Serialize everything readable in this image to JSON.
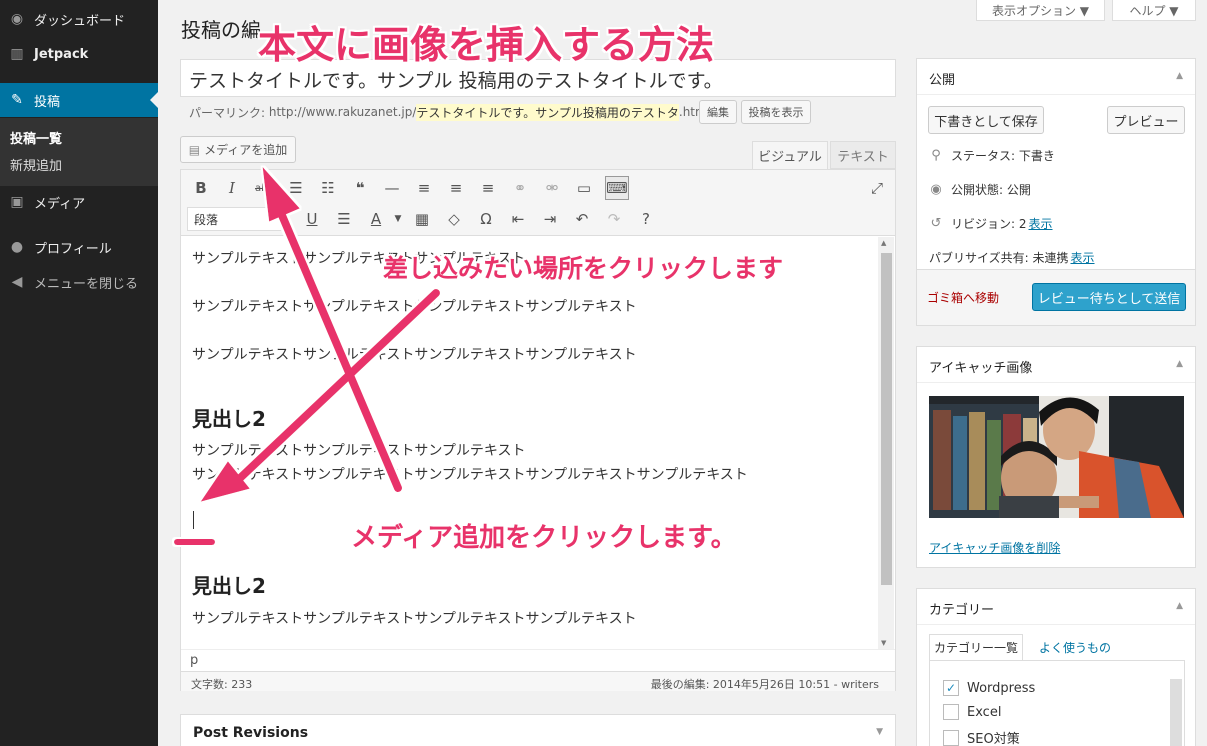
{
  "sidebar": {
    "items": [
      {
        "label": "ダッシュボード",
        "icon": "dashboard-icon"
      },
      {
        "label": "Jetpack",
        "icon": "jetpack-icon"
      },
      {
        "label": "投稿",
        "icon": "pin-icon"
      },
      {
        "label": "メディア",
        "icon": "media-icon"
      },
      {
        "label": "プロフィール",
        "icon": "user-icon"
      },
      {
        "label": "メニューを閉じる",
        "icon": "collapse-icon"
      }
    ],
    "submenu": [
      "投稿一覧",
      "新規追加"
    ]
  },
  "header": {
    "page_title": "投稿の編",
    "screen_options": "表示オプション ▼",
    "help": "ヘルプ ▼"
  },
  "post": {
    "title": "テストタイトルです。サンプル 投稿用のテストタイトルです。",
    "permalink_label": "パーマリンク:",
    "permalink_base": "http://www.rakuzanet.jp/",
    "permalink_slug": "テストタイトルです。サンプル投稿用のテストタ",
    "permalink_ext": ".html",
    "edit_button": "編集",
    "view_button": "投稿を表示"
  },
  "editor": {
    "add_media": "メディアを追加",
    "tab_visual": "ビジュアル",
    "tab_text": "テキスト",
    "format": "段落",
    "lines": [
      "サンプルテキストサンプルテキストサンプルテキスト",
      "サンプルテキストサンプルテキストサンプルテキストサンプルテキスト",
      "サンプルテキストサンプルテキストサンプルテキストサンプルテキスト",
      "見出し2",
      "サンプルテキストサンプルテキストサンプルテキスト",
      "サンプルテキストサンプルテキストサンプルテキストサンプルテキストサンプルテキスト",
      "見出し2",
      "サンプルテキストサンプルテキストサンプルテキストサンプルテキスト"
    ],
    "path": "p",
    "word_count": "文字数: 233",
    "last_edit": "最後の編集: 2014年5月26日 10:51 - writers"
  },
  "revisions": {
    "title": "Post Revisions"
  },
  "publish": {
    "title": "公開",
    "save_draft": "下書きとして保存",
    "preview": "プレビュー",
    "status": "ステータス: 下書き",
    "visibility": "公開状態: 公開",
    "revisions_label": "リビジョン: 2",
    "revisions_link": "表示",
    "publicize_label": "パブリサイズ共有: 未連携",
    "publicize_link": "表示",
    "trash": "ゴミ箱へ移動",
    "submit": "レビュー待ちとして送信"
  },
  "featured": {
    "title": "アイキャッチ画像",
    "remove": "アイキャッチ画像を削除"
  },
  "categories": {
    "title": "カテゴリー",
    "tab_all": "カテゴリー一覧",
    "tab_popular": "よく使うもの",
    "items": [
      {
        "label": "Wordpress",
        "checked": true
      },
      {
        "label": "Excel",
        "checked": false
      },
      {
        "label": "SEO対策",
        "checked": false
      }
    ]
  },
  "annotations": {
    "headline": "本文に画像を挿入する方法",
    "click_place": "差し込みたい場所をクリックします",
    "click_media": "メディア追加をクリックします。"
  },
  "colors": {
    "accent": "#0074a2",
    "annotation": "#e8336a"
  }
}
